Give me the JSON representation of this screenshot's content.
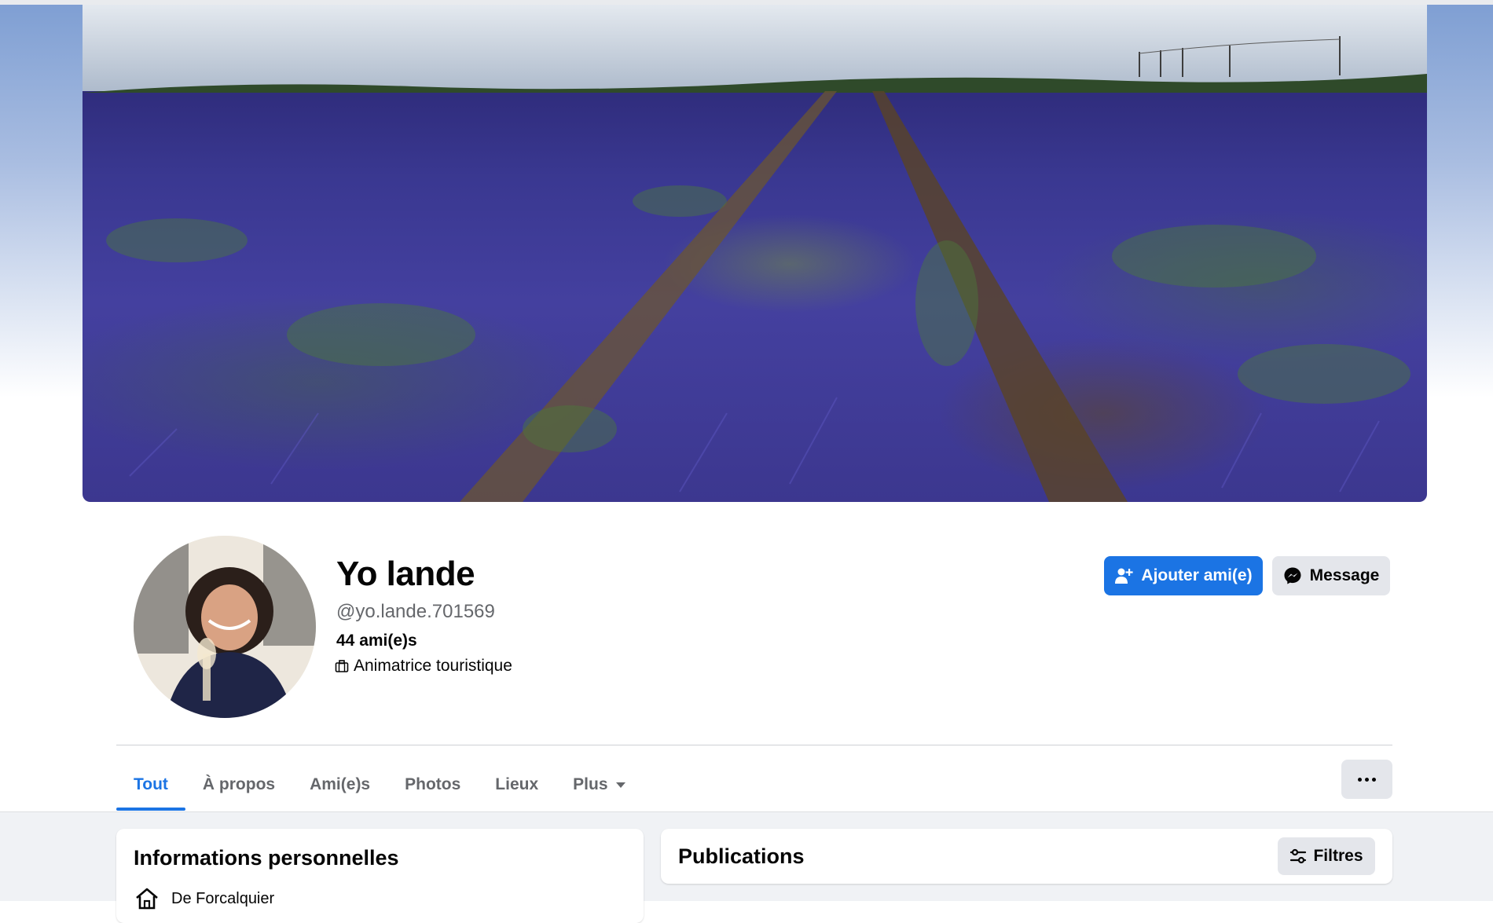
{
  "profile": {
    "name": "Yo lande",
    "handle": "@yo.lande.701569",
    "friends": "44 ami(e)s",
    "job": "Animatrice touristique"
  },
  "actions": {
    "add_friend": "Ajouter ami(e)",
    "message": "Message"
  },
  "tabs": [
    {
      "label": "Tout",
      "active": true
    },
    {
      "label": "À propos"
    },
    {
      "label": "Ami(e)s"
    },
    {
      "label": "Photos"
    },
    {
      "label": "Lieux"
    },
    {
      "label": "Plus",
      "has_caret": true
    }
  ],
  "info_card": {
    "title": "Informations personnelles",
    "location": "De Forcalquier"
  },
  "posts_card": {
    "title": "Publications",
    "filter_label": "Filtres"
  },
  "colors": {
    "accent": "#1b74e4",
    "secondary_button": "#e4e6eb",
    "muted_text": "#65676b",
    "feed_background": "#f0f2f5"
  },
  "icons": {
    "add_friend": "person-plus-icon",
    "message": "messenger-icon",
    "job": "briefcase-icon",
    "location": "home-icon",
    "filter": "sliders-icon",
    "more": "more-dots-icon"
  }
}
